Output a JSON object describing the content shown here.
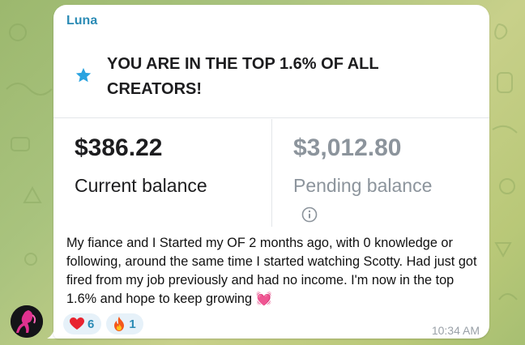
{
  "message": {
    "sender": "Luna",
    "card": {
      "headline": "YOU ARE IN THE TOP 1.6% OF ALL CREATORS!",
      "current_amount": "$386.22",
      "current_label": "Current balance",
      "pending_amount": "$3,012.80",
      "pending_label": "Pending balance"
    },
    "text": "My fiance and I Started my OF 2 months ago, with 0 knowledge or following, around the same time I started watching Scotty. Had just got fired from my job previously and had no income. I'm now in the top 1.6% and hope to keep growing 💓",
    "reactions": [
      {
        "icon": "heart-icon",
        "count": "6"
      },
      {
        "icon": "fire-icon",
        "count": "1"
      }
    ],
    "time": "10:34 AM"
  },
  "colors": {
    "sender": "#2b8bb5",
    "star": "#29a3e0",
    "reaction_bg": "#e6f1f9",
    "pending": "#8c949c"
  }
}
